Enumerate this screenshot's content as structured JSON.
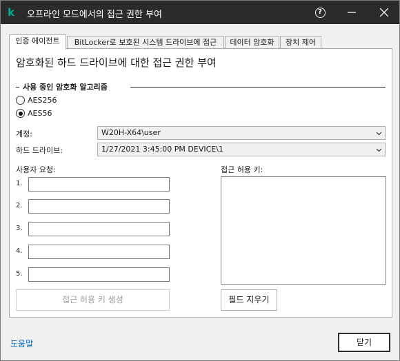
{
  "window": {
    "title": "오프라인 모드에서의 접근 권한 부여",
    "logo_letter": "k"
  },
  "tabs": [
    {
      "label": "인증 에이전트"
    },
    {
      "label": "BitLocker로 보호된 시스템 드라이브에 접근"
    },
    {
      "label": "데이터 암호화"
    },
    {
      "label": "장치 제어"
    }
  ],
  "panel": {
    "title": "암호화된 하드 드라이브에 대한 접근 권한 부여",
    "algorithm_group_label": "사용 중인 암호화 알고리즘",
    "algorithms": [
      {
        "label": "AES256",
        "checked": false
      },
      {
        "label": "AES56",
        "checked": true
      }
    ],
    "account_label": "계정:",
    "account_value": "W20H-X64\\user",
    "drive_label": "하드 드라이브:",
    "drive_value": "1/27/2021 3:45:00 PM   DEVICE\\1",
    "user_request_label": "사용자 요청:",
    "request_numbers": [
      "1.",
      "2.",
      "3.",
      "4.",
      "5."
    ],
    "access_key_label": "접근 허용 키:",
    "generate_button": "접근 허용 키 생성",
    "clear_button": "필드 지우기"
  },
  "footer": {
    "help_link": "도움말",
    "close_button": "닫기"
  }
}
